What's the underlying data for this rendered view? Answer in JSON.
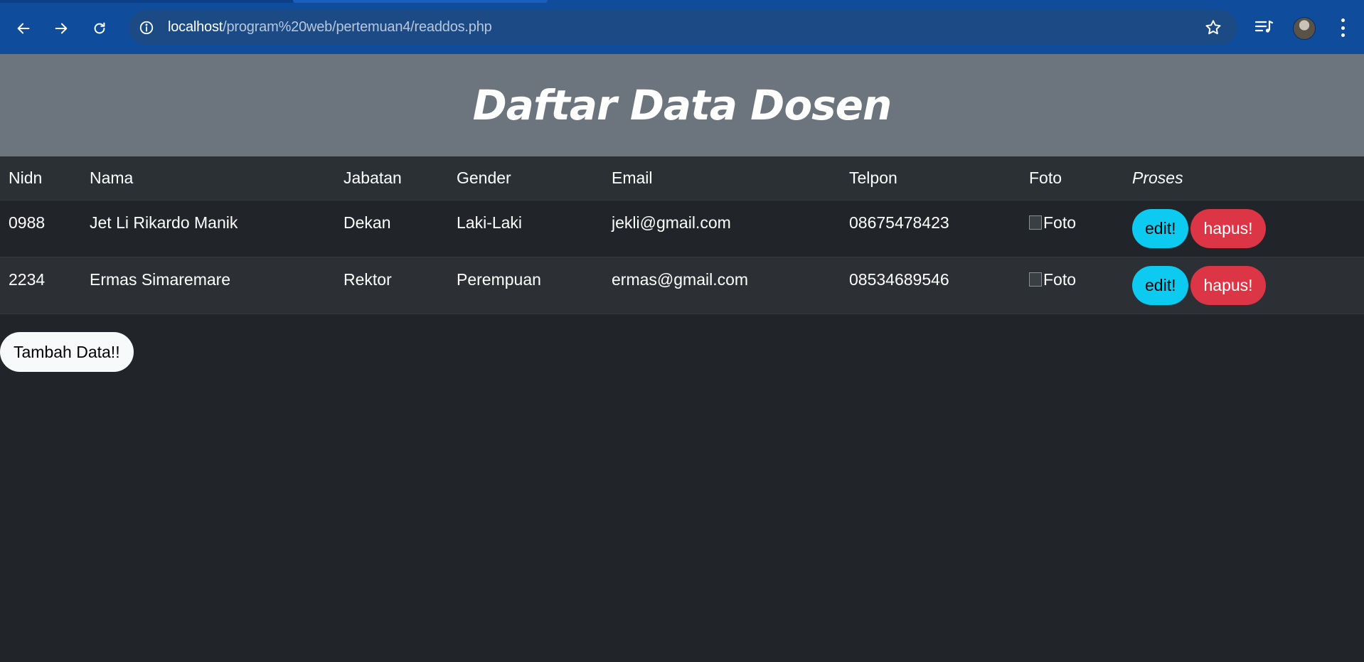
{
  "browser": {
    "url_host": "localhost",
    "url_path": "/program%20web/pertemuan4/readdos.php"
  },
  "page": {
    "title": "Daftar Data Dosen",
    "add_button": "Tambah Data!!"
  },
  "table": {
    "headers": {
      "nidn": "Nidn",
      "nama": "Nama",
      "jabatan": "Jabatan",
      "gender": "Gender",
      "email": "Email",
      "telpon": "Telpon",
      "foto": "Foto",
      "proses": "Proses"
    },
    "rows": [
      {
        "nidn": "0988",
        "nama": "Jet Li Rikardo Manik",
        "jabatan": "Dekan",
        "gender": "Laki-Laki",
        "email": "jekli@gmail.com",
        "telpon": "08675478423",
        "foto_alt": "Foto",
        "edit_label": "edit!",
        "hapus_label": "hapus!"
      },
      {
        "nidn": "2234",
        "nama": "Ermas Simaremare",
        "jabatan": "Rektor",
        "gender": "Perempuan",
        "email": "ermas@gmail.com",
        "telpon": "08534689546",
        "foto_alt": "Foto",
        "edit_label": "edit!",
        "hapus_label": "hapus!"
      }
    ]
  },
  "colors": {
    "page_bg": "#212529",
    "header_bg": "#6c757d",
    "edit_button": "#0dcaf0",
    "hapus_button": "#dc3545",
    "browser_bar": "#0f4c9c"
  }
}
